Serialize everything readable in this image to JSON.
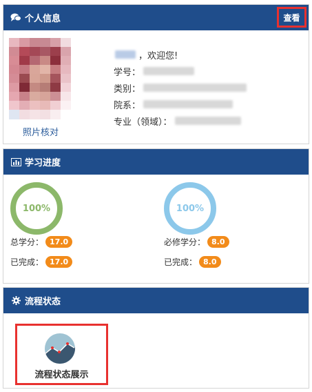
{
  "personal": {
    "title": "个人信息",
    "view_button": "查看",
    "photo_link": "照片核对",
    "welcome": "，欢迎您!",
    "fields": {
      "student_id": "学号：",
      "category": "类别：",
      "department": "院系：",
      "major": "专业（领域）："
    }
  },
  "progress": {
    "title": "学习进度",
    "total": {
      "percent_label": "100%",
      "percent": 100,
      "credit_label": "总学分：",
      "credit_value": "17.0",
      "done_label": "已完成：",
      "done_value": "17.0",
      "color": "#8cb86a"
    },
    "required": {
      "percent_label": "100%",
      "percent": 100,
      "credit_label": "必修学分：",
      "credit_value": "8.0",
      "done_label": "已完成：",
      "done_value": "8.0",
      "color": "#8cc8ea"
    }
  },
  "flow": {
    "title": "流程状态",
    "item_label": "流程状态展示"
  },
  "colors": {
    "header": "#1f4d8b",
    "highlight": "#e8312f",
    "badge": "#f28b1a"
  },
  "icons": {
    "personal": "comments-icon",
    "progress": "bar-chart-icon",
    "flow": "gear-icon"
  }
}
